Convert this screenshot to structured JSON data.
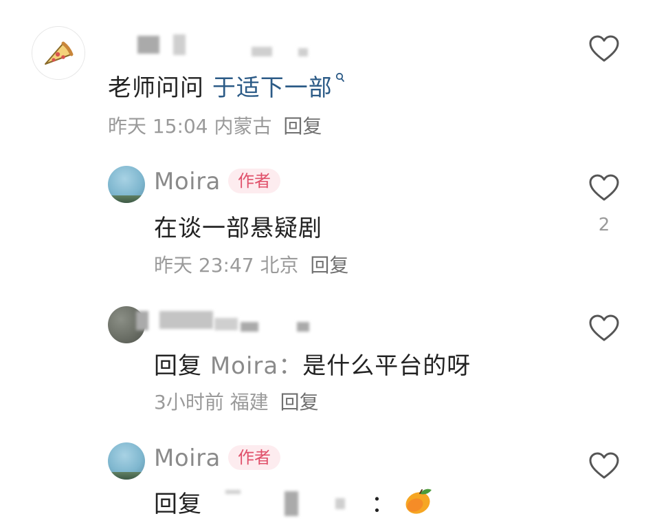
{
  "comments": [
    {
      "avatar_icon": "pizza-slice-icon",
      "text_prefix": "老师问问 ",
      "text_link": "于适下一部",
      "link_icon": "search-icon",
      "time": "昨天 15:04",
      "location": "内蒙古",
      "reply_label": "回复"
    },
    {
      "author": "Moira",
      "badge": "作者",
      "text": "在谈一部悬疑剧",
      "time": "昨天 23:47",
      "location": "北京",
      "reply_label": "回复",
      "likes": "2"
    },
    {
      "text_prefix": "回复",
      "reply_to": "Moira：",
      "text": "是什么平台的呀",
      "time": "3小时前",
      "location": "福建",
      "reply_label": "回复"
    },
    {
      "author": "Moira",
      "badge": "作者",
      "text_prefix": "回复",
      "colon": "：",
      "emoji_icon": "mango-icon"
    }
  ],
  "colors": {
    "badge_text": "#e0506a",
    "badge_bg": "#fdecef",
    "link": "#2b5a86",
    "meta": "#9a9a9a"
  }
}
